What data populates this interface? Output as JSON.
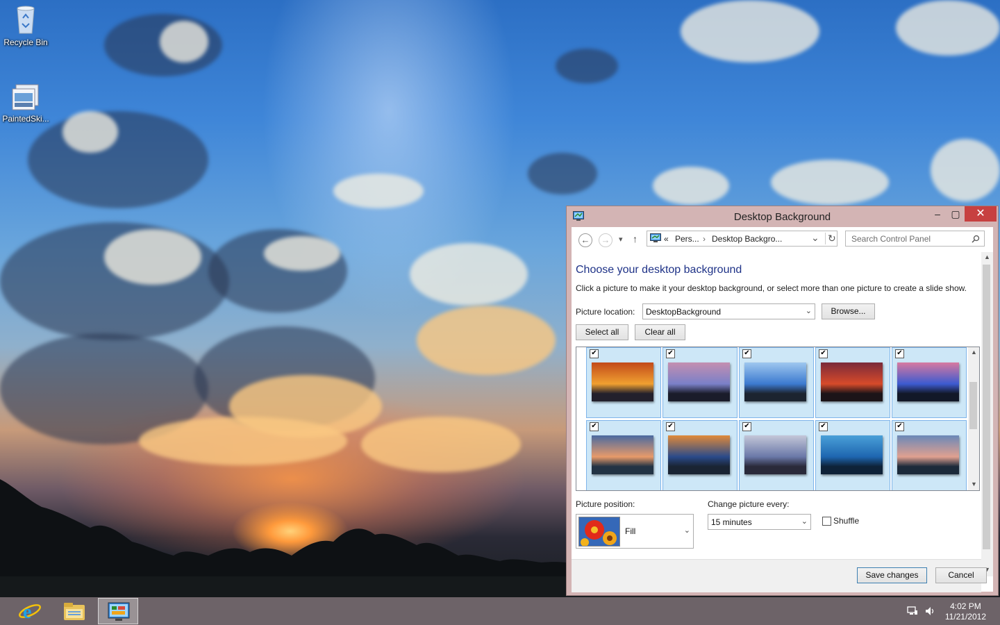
{
  "desktop": {
    "icons": [
      {
        "label": "Recycle Bin",
        "icon": "recycle-bin-icon"
      },
      {
        "label": "PaintedSki...",
        "icon": "theme-pack-icon"
      }
    ]
  },
  "window": {
    "title": "Desktop Background",
    "controls": {
      "minimize": "–",
      "maximize": "▢",
      "close": "✕"
    },
    "nav": {
      "back": "←",
      "forward": "→",
      "recent": "▾",
      "up": "↑",
      "breadcrumb_prefix": "«",
      "breadcrumb": [
        "Pers...",
        "Desktop Backgro..."
      ],
      "breadcrumb_sep": "›",
      "address_dropdown": "⌄",
      "refresh": "↻",
      "search_placeholder": "Search Control Panel",
      "search_icon": "🔍"
    },
    "heading": "Choose your desktop background",
    "subtext": "Click a picture to make it your desktop background, or select more than one picture to create a slide show.",
    "picture_location_label": "Picture location:",
    "picture_location_value": "DesktopBackground",
    "browse_label": "Browse...",
    "select_all_label": "Select all",
    "clear_all_label": "Clear all",
    "check_mark": "✔",
    "thumbnails": [
      {
        "name": "sunset-1",
        "checked": true
      },
      {
        "name": "sunset-2",
        "checked": true
      },
      {
        "name": "sunset-3",
        "checked": true
      },
      {
        "name": "sunset-4",
        "checked": true
      },
      {
        "name": "sunset-5",
        "checked": true
      },
      {
        "name": "sunset-6",
        "checked": true
      },
      {
        "name": "sunset-7",
        "checked": true
      },
      {
        "name": "sunset-8",
        "checked": true
      },
      {
        "name": "sunset-9",
        "checked": true
      },
      {
        "name": "sunset-10",
        "checked": true
      }
    ],
    "picture_position_label": "Picture position:",
    "picture_position_value": "Fill",
    "change_every_label": "Change picture every:",
    "change_every_value": "15 minutes",
    "shuffle_label": "Shuffle",
    "shuffle_checked": false,
    "save_label": "Save changes",
    "cancel_label": "Cancel",
    "scroll_up": "▲",
    "scroll_down": "▼",
    "combo_arrow": "⌄"
  },
  "taskbar": {
    "items": [
      {
        "icon": "internet-explorer-icon",
        "glyph": "e"
      },
      {
        "icon": "file-explorer-icon"
      },
      {
        "icon": "control-panel-icon",
        "active": true
      }
    ],
    "tray": {
      "network_icon": "network-icon",
      "volume_icon": "volume-icon"
    },
    "time": "4:02 PM",
    "date": "11/21/2012"
  },
  "colors": {
    "window_frame": "#d3b4b4",
    "heading": "#1e3287",
    "tile_selected": "#cde7f7",
    "close_button": "#c74040",
    "taskbar": "#6d6368"
  }
}
